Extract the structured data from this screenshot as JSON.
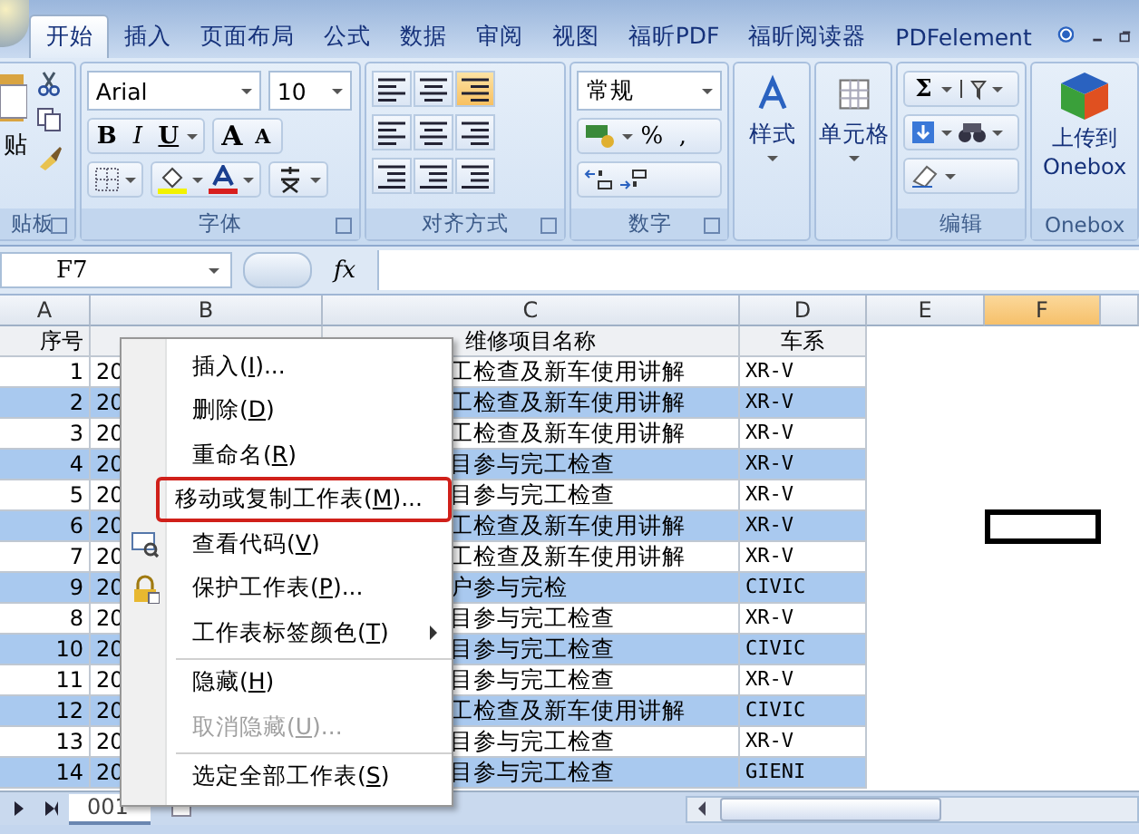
{
  "ribbon_tabs": [
    {
      "label": "开始",
      "selected": true
    },
    {
      "label": "插入",
      "selected": false
    },
    {
      "label": "页面布局",
      "selected": false
    },
    {
      "label": "公式",
      "selected": false
    },
    {
      "label": "数据",
      "selected": false
    },
    {
      "label": "审阅",
      "selected": false
    },
    {
      "label": "视图",
      "selected": false
    },
    {
      "label": "福昕PDF",
      "selected": false
    },
    {
      "label": "福昕阅读器",
      "selected": false
    },
    {
      "label": "PDFelement",
      "selected": false
    }
  ],
  "clipboard": {
    "paste_label": "贴",
    "label": "贴板"
  },
  "font": {
    "font_name": "Arial",
    "font_size": "10",
    "bold": "B",
    "italic": "I",
    "underline": "U",
    "grow": "A",
    "shrink": "A",
    "label": "字体"
  },
  "alignment": {
    "label": "对齐方式"
  },
  "number": {
    "format": "常规",
    "percent": "%",
    "comma": ",",
    "label": "数字"
  },
  "styles": {
    "button_label": "样式"
  },
  "cells": {
    "button_label": "单元格"
  },
  "editing": {
    "sum": "Σ",
    "label": "编辑"
  },
  "onebox": {
    "button_lines": [
      "上传到",
      "Onebox"
    ],
    "label": "Onebox"
  },
  "formula_bar": {
    "name_box": "F7",
    "fx": "fx"
  },
  "columns": [
    {
      "label": "A",
      "selected": false
    },
    {
      "label": "B",
      "selected": false
    },
    {
      "label": "C",
      "selected": false
    },
    {
      "label": "D",
      "selected": false
    },
    {
      "label": "E",
      "selected": false
    },
    {
      "label": "F",
      "selected": true
    }
  ],
  "header_row": {
    "a": "序号",
    "c": "维修项目名称",
    "d": "车系"
  },
  "rows": [
    {
      "a": "1",
      "b": "20",
      "c": "工检查及新车使用讲解",
      "d": "XR-V",
      "shaded": false,
      "f_active": false
    },
    {
      "a": "2",
      "b": "20",
      "c": "工检查及新车使用讲解",
      "d": "XR-V",
      "shaded": true,
      "f_active": false
    },
    {
      "a": "3",
      "b": "20",
      "c": "工检查及新车使用讲解",
      "d": "XR-V",
      "shaded": false,
      "f_active": false
    },
    {
      "a": "4",
      "b": "20",
      "c": "目参与完工检查",
      "d": "XR-V",
      "shaded": true,
      "f_active": false
    },
    {
      "a": "5",
      "b": "20",
      "c": "目参与完工检查",
      "d": "XR-V",
      "shaded": false,
      "f_active": false
    },
    {
      "a": "6",
      "b": "20",
      "c": "工检查及新车使用讲解",
      "d": "XR-V",
      "shaded": true,
      "f_active": true
    },
    {
      "a": "7",
      "b": "20",
      "c": "工检查及新车使用讲解",
      "d": "XR-V",
      "shaded": false,
      "f_active": false
    },
    {
      "a": "9",
      "b": "20",
      "c": "户参与完检",
      "d": "CIVIC",
      "shaded": true,
      "f_active": false
    },
    {
      "a": "8",
      "b": "20",
      "c": "目参与完工检查",
      "d": "XR-V",
      "shaded": false,
      "f_active": false
    },
    {
      "a": "10",
      "b": "20",
      "c": "目参与完工检查",
      "d": "CIVIC",
      "shaded": true,
      "f_active": false
    },
    {
      "a": "11",
      "b": "20",
      "c": "目参与完工检查",
      "d": "XR-V",
      "shaded": false,
      "f_active": false
    },
    {
      "a": "12",
      "b": "20",
      "c": "工检查及新车使用讲解",
      "d": "CIVIC",
      "shaded": true,
      "f_active": false
    },
    {
      "a": "13",
      "b": "20",
      "c": "目参与完工检查",
      "d": "XR-V",
      "shaded": false,
      "f_active": false
    },
    {
      "a": "14",
      "b": "20",
      "c": "目参与完工检查",
      "d": "GIENI",
      "shaded": true,
      "f_active": false
    }
  ],
  "sheet_tabs": [
    {
      "label": "001",
      "selected": true
    }
  ],
  "context_menu": [
    {
      "kind": "item",
      "before": "插入(",
      "key": "I",
      "after": ")...",
      "disabled": false,
      "submenu": false,
      "annotated": false
    },
    {
      "kind": "item",
      "before": "删除(",
      "key": "D",
      "after": ")",
      "disabled": false,
      "submenu": false,
      "annotated": false
    },
    {
      "kind": "item",
      "before": "重命名(",
      "key": "R",
      "after": ")",
      "disabled": false,
      "submenu": false,
      "annotated": false
    },
    {
      "kind": "item",
      "before": "移动或复制工作表(",
      "key": "M",
      "after": ")...",
      "disabled": false,
      "submenu": false,
      "annotated": true
    },
    {
      "kind": "code_item",
      "before": "查看代码(",
      "key": "V",
      "after": ")",
      "disabled": false,
      "submenu": false,
      "annotated": false
    },
    {
      "kind": "lock_item",
      "before": "保护工作表(",
      "key": "P",
      "after": ")...",
      "disabled": false,
      "submenu": false,
      "annotated": false
    },
    {
      "kind": "item",
      "before": "工作表标签颜色(",
      "key": "T",
      "after": ")",
      "disabled": false,
      "submenu": true,
      "annotated": false
    },
    {
      "kind": "separator"
    },
    {
      "kind": "item",
      "before": "隐藏(",
      "key": "H",
      "after": ")",
      "disabled": false,
      "submenu": false,
      "annotated": false
    },
    {
      "kind": "item",
      "before": "取消隐藏(",
      "key": "U",
      "after": ")...",
      "disabled": true,
      "submenu": false,
      "annotated": false
    },
    {
      "kind": "separator"
    },
    {
      "kind": "item",
      "before": "选定全部工作表(",
      "key": "S",
      "after": ")",
      "disabled": false,
      "submenu": false,
      "annotated": false
    }
  ]
}
